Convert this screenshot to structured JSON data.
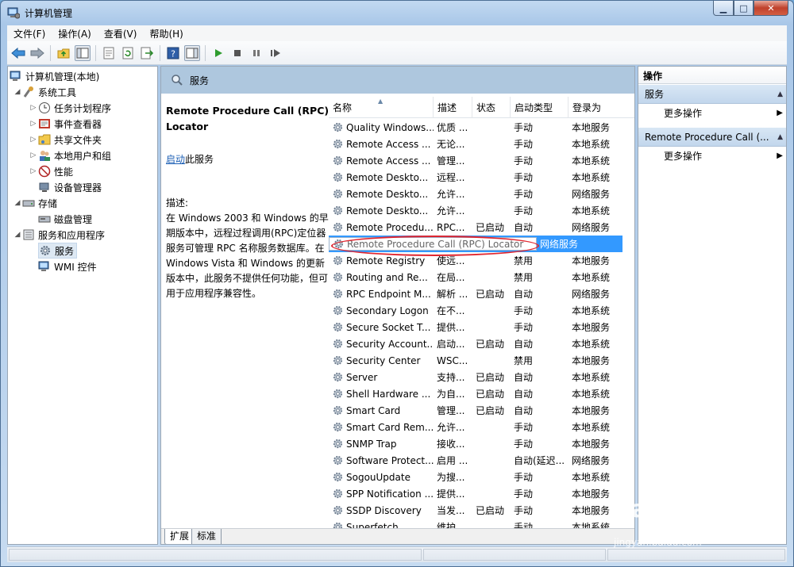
{
  "window": {
    "title": "计算机管理"
  },
  "menu": [
    "文件(F)",
    "操作(A)",
    "查看(V)",
    "帮助(H)"
  ],
  "tree": {
    "root": "计算机管理(本地)",
    "system_tools": "系统工具",
    "task_scheduler": "任务计划程序",
    "event_viewer": "事件查看器",
    "shared_folders": "共享文件夹",
    "local_users": "本地用户和组",
    "performance": "性能",
    "device_manager": "设备管理器",
    "storage": "存储",
    "disk_management": "磁盘管理",
    "services_apps": "服务和应用程序",
    "services": "服务",
    "wmi": "WMI 控件"
  },
  "panel": {
    "title": "服务"
  },
  "details": {
    "service_name": "Remote Procedure Call (RPC) Locator",
    "start_link": "启动",
    "start_suffix": "此服务",
    "desc_label": "描述:",
    "description": "在 Windows 2003 和 Windows 的早期版本中，远程过程调用(RPC)定位器服务可管理 RPC 名称服务数据库。在 Windows Vista 和 Windows 的更新版本中，此服务不提供任何功能，但可用于应用程序兼容性。"
  },
  "columns": [
    "名称",
    "描述",
    "状态",
    "启动类型",
    "登录为"
  ],
  "rows": [
    {
      "name": "Quality Windows...",
      "desc": "优质 ...",
      "status": "",
      "startup": "手动",
      "logon": "本地服务"
    },
    {
      "name": "Remote Access ...",
      "desc": "无论...",
      "status": "",
      "startup": "手动",
      "logon": "本地系统"
    },
    {
      "name": "Remote Access ...",
      "desc": "管理...",
      "status": "",
      "startup": "手动",
      "logon": "本地系统"
    },
    {
      "name": "Remote Deskto...",
      "desc": "远程...",
      "status": "",
      "startup": "手动",
      "logon": "本地系统"
    },
    {
      "name": "Remote Deskto...",
      "desc": "允许...",
      "status": "",
      "startup": "手动",
      "logon": "网络服务"
    },
    {
      "name": "Remote Deskto...",
      "desc": "允许...",
      "status": "",
      "startup": "手动",
      "logon": "本地系统"
    },
    {
      "name": "Remote Procedu...",
      "desc": "RPC...",
      "status": "已启动",
      "startup": "自动",
      "logon": "网络服务"
    },
    {
      "name": "Remote Procedure Call (RPC) Locator",
      "desc": "",
      "status": "",
      "startup": "",
      "logon": "网络服务",
      "selected": true
    },
    {
      "name": "Remote Registry",
      "desc": "使远...",
      "status": "",
      "startup": "禁用",
      "logon": "本地服务"
    },
    {
      "name": "Routing and Re...",
      "desc": "在局...",
      "status": "",
      "startup": "禁用",
      "logon": "本地系统"
    },
    {
      "name": "RPC Endpoint M...",
      "desc": "解析 ...",
      "status": "已启动",
      "startup": "自动",
      "logon": "网络服务"
    },
    {
      "name": "Secondary Logon",
      "desc": "在不...",
      "status": "",
      "startup": "手动",
      "logon": "本地系统"
    },
    {
      "name": "Secure Socket T...",
      "desc": "提供...",
      "status": "",
      "startup": "手动",
      "logon": "本地服务"
    },
    {
      "name": "Security Account...",
      "desc": "启动...",
      "status": "已启动",
      "startup": "自动",
      "logon": "本地系统"
    },
    {
      "name": "Security Center",
      "desc": "WSC...",
      "status": "",
      "startup": "禁用",
      "logon": "本地服务"
    },
    {
      "name": "Server",
      "desc": "支持...",
      "status": "已启动",
      "startup": "自动",
      "logon": "本地系统"
    },
    {
      "name": "Shell Hardware ...",
      "desc": "为自...",
      "status": "已启动",
      "startup": "自动",
      "logon": "本地系统"
    },
    {
      "name": "Smart Card",
      "desc": "管理...",
      "status": "已启动",
      "startup": "自动",
      "logon": "本地服务"
    },
    {
      "name": "Smart Card Rem...",
      "desc": "允许...",
      "status": "",
      "startup": "手动",
      "logon": "本地系统"
    },
    {
      "name": "SNMP Trap",
      "desc": "接收...",
      "status": "",
      "startup": "手动",
      "logon": "本地服务"
    },
    {
      "name": "Software Protect...",
      "desc": "启用 ...",
      "status": "",
      "startup": "自动(延迟...",
      "logon": "网络服务"
    },
    {
      "name": "SogouUpdate",
      "desc": "为搜...",
      "status": "",
      "startup": "手动",
      "logon": "本地系统"
    },
    {
      "name": "SPP Notification ...",
      "desc": "提供...",
      "status": "",
      "startup": "手动",
      "logon": "本地服务"
    },
    {
      "name": "SSDP Discovery",
      "desc": "当发...",
      "status": "已启动",
      "startup": "手动",
      "logon": "本地服务"
    },
    {
      "name": "Superfetch",
      "desc": "维护...",
      "status": "",
      "startup": "手动",
      "logon": "本地系统"
    }
  ],
  "tabs": {
    "extended": "扩展",
    "standard": "标准"
  },
  "actions": {
    "title": "操作",
    "section1": "服务",
    "section1_more": "更多操作",
    "section2": "Remote Procedure Call (...",
    "section2_more": "更多操作"
  },
  "watermark": {
    "brand": "Baidu经验",
    "url": "jingyan.baidu.com"
  }
}
